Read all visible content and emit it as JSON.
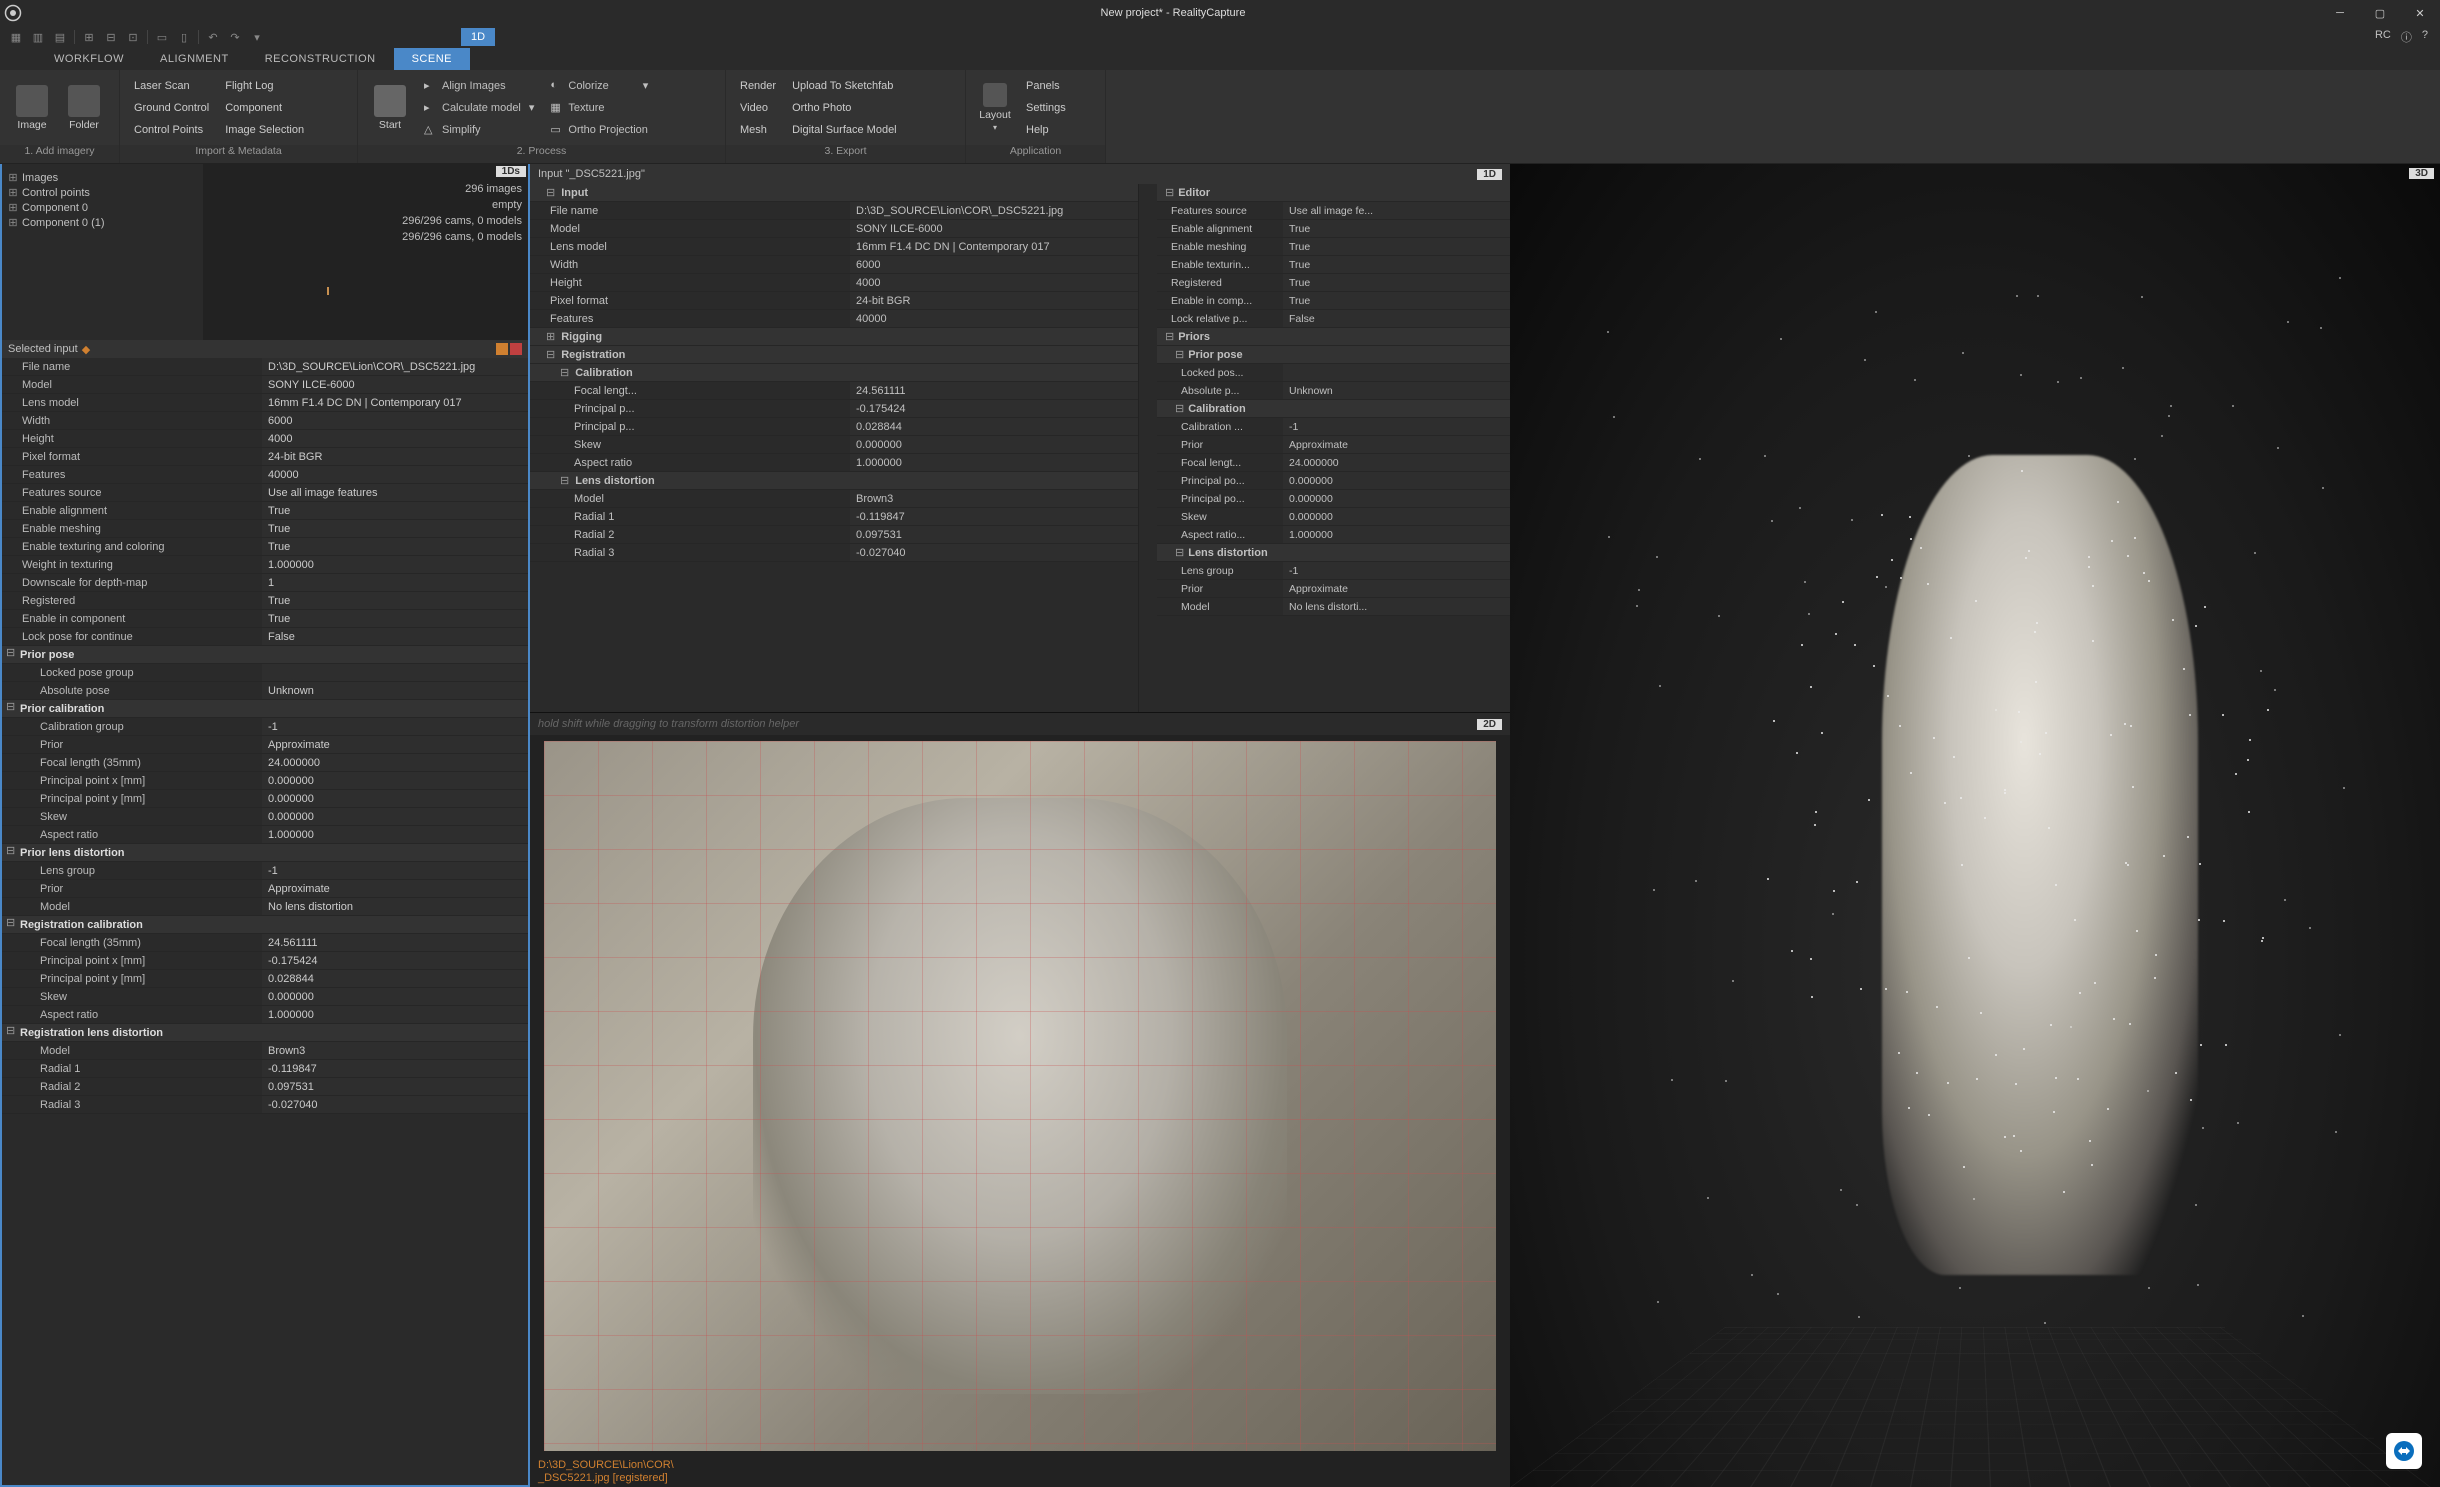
{
  "title": "New project* - RealityCapture",
  "rc_label": "RC",
  "ribbon_tabs": [
    "WORKFLOW",
    "ALIGNMENT",
    "RECONSTRUCTION",
    "SCENE"
  ],
  "active_tab": "SCENE",
  "ribbon": {
    "g1": {
      "label": "1. Add imagery",
      "image": "Image",
      "folder": "Folder",
      "laser": "Laser Scan",
      "flight": "Flight Log",
      "ground": "Ground Control",
      "component": "Component",
      "control": "Control Points",
      "imgsel": "Image Selection"
    },
    "g2": {
      "label": "Import & Metadata"
    },
    "g3": {
      "label": "2. Process",
      "start": "Start",
      "align": "Align Images",
      "calc": "Calculate model",
      "simplify": "Simplify",
      "colorize": "Colorize",
      "texture": "Texture",
      "ortho": "Ortho Projection"
    },
    "g4": {
      "label": "3. Export",
      "render": "Render",
      "video": "Video",
      "mesh": "Mesh",
      "upload": "Upload To Sketchfab",
      "orthop": "Ortho Photo",
      "dsm": "Digital Surface Model"
    },
    "g5": {
      "label": "Application",
      "layout": "Layout",
      "panels": "Panels",
      "settings": "Settings",
      "help": "Help"
    }
  },
  "tree": {
    "images": "Images",
    "control": "Control points",
    "comp0": "Component 0",
    "comp01": "Component 0 (1)"
  },
  "stats": {
    "tag": "1Ds",
    "l1": "296 images",
    "l2": "empty",
    "l3": "296/296 cams, 0 models",
    "l4": "296/296 cams, 0 models"
  },
  "selected_header": "Selected input",
  "sel": [
    {
      "k": "File name",
      "v": "D:\\3D_SOURCE\\Lion\\COR\\_DSC5221.jpg"
    },
    {
      "k": "Model",
      "v": "SONY ILCE-6000"
    },
    {
      "k": "Lens model",
      "v": "16mm F1.4 DC DN | Contemporary 017"
    },
    {
      "k": "Width",
      "v": "6000"
    },
    {
      "k": "Height",
      "v": "4000"
    },
    {
      "k": "Pixel format",
      "v": "24-bit BGR"
    },
    {
      "k": "Features",
      "v": "40000"
    },
    {
      "k": "Features source",
      "v": "Use all image features"
    },
    {
      "k": "Enable alignment",
      "v": "True"
    },
    {
      "k": "Enable meshing",
      "v": "True"
    },
    {
      "k": "Enable texturing and coloring",
      "v": "True"
    },
    {
      "k": "Weight in texturing",
      "v": "1.000000"
    },
    {
      "k": "Downscale for depth-map",
      "v": "1"
    },
    {
      "k": "Registered",
      "v": "True"
    },
    {
      "k": "Enable in component",
      "v": "True"
    },
    {
      "k": "Lock pose for continue",
      "v": "False"
    }
  ],
  "sel_sections": {
    "prior_pose": "Prior pose",
    "prior_pose_rows": [
      {
        "k": "Locked pose group",
        "v": ""
      },
      {
        "k": "Absolute pose",
        "v": "Unknown"
      }
    ],
    "prior_cal": "Prior calibration",
    "prior_cal_rows": [
      {
        "k": "Calibration group",
        "v": "-1"
      },
      {
        "k": "Prior",
        "v": "Approximate"
      },
      {
        "k": "Focal length (35mm)",
        "v": "24.000000"
      },
      {
        "k": "Principal point x [mm]",
        "v": "0.000000"
      },
      {
        "k": "Principal point y [mm]",
        "v": "0.000000"
      },
      {
        "k": "Skew",
        "v": "0.000000"
      },
      {
        "k": "Aspect ratio",
        "v": "1.000000"
      }
    ],
    "prior_lens": "Prior lens distortion",
    "prior_lens_rows": [
      {
        "k": "Lens group",
        "v": "-1"
      },
      {
        "k": "Prior",
        "v": "Approximate"
      },
      {
        "k": "Model",
        "v": "No lens distortion"
      }
    ],
    "reg_cal": "Registration calibration",
    "reg_cal_rows": [
      {
        "k": "Focal length (35mm)",
        "v": "24.561111"
      },
      {
        "k": "Principal point x [mm]",
        "v": "-0.175424"
      },
      {
        "k": "Principal point y [mm]",
        "v": "0.028844"
      },
      {
        "k": "Skew",
        "v": "0.000000"
      },
      {
        "k": "Aspect ratio",
        "v": "1.000000"
      }
    ],
    "reg_lens": "Registration lens distortion",
    "reg_lens_rows": [
      {
        "k": "Model",
        "v": "Brown3"
      },
      {
        "k": "Radial 1",
        "v": "-0.119847"
      },
      {
        "k": "Radial 2",
        "v": "0.097531"
      },
      {
        "k": "Radial 3",
        "v": "-0.027040"
      }
    ]
  },
  "mid_header": "Input \"_DSC5221.jpg\"",
  "mid_tag": "1D",
  "input_section": "Input",
  "input_rows": [
    {
      "k": "File name",
      "v": "D:\\3D_SOURCE\\Lion\\COR\\_DSC5221.jpg"
    },
    {
      "k": "Model",
      "v": "SONY ILCE-6000"
    },
    {
      "k": "Lens model",
      "v": "16mm F1.4 DC DN | Contemporary 017"
    },
    {
      "k": "Width",
      "v": "6000"
    },
    {
      "k": "Height",
      "v": "4000"
    },
    {
      "k": "Pixel format",
      "v": "24-bit BGR"
    },
    {
      "k": "Features",
      "v": "40000"
    }
  ],
  "rigging": "Rigging",
  "registration": "Registration",
  "calibration": "Calibration",
  "cal_rows": [
    {
      "k": "Focal lengt...",
      "v": "24.561111"
    },
    {
      "k": "Principal p...",
      "v": "-0.175424"
    },
    {
      "k": "Principal p...",
      "v": "0.028844"
    },
    {
      "k": "Skew",
      "v": "0.000000"
    },
    {
      "k": "Aspect ratio",
      "v": "1.000000"
    }
  ],
  "lens_dist": "Lens distortion",
  "lens_rows": [
    {
      "k": "Model",
      "v": "Brown3"
    },
    {
      "k": "Radial 1",
      "v": "-0.119847"
    },
    {
      "k": "Radial 2",
      "v": "0.097531"
    },
    {
      "k": "Radial 3",
      "v": "-0.027040"
    }
  ],
  "editor": "Editor",
  "editor_rows": [
    {
      "k": "Features source",
      "v": "Use all image fe..."
    },
    {
      "k": "Enable alignment",
      "v": "True"
    },
    {
      "k": "Enable meshing",
      "v": "True"
    },
    {
      "k": "Enable texturin...",
      "v": "True"
    },
    {
      "k": "Registered",
      "v": "True"
    },
    {
      "k": "Enable in comp...",
      "v": "True"
    },
    {
      "k": "Lock relative p...",
      "v": "False"
    }
  ],
  "priors": "Priors",
  "priors_pose": "Prior pose",
  "priors_pose_rows": [
    {
      "k": "Locked pos...",
      "v": ""
    },
    {
      "k": "Absolute p...",
      "v": "Unknown"
    }
  ],
  "priors_cal": "Calibration",
  "priors_cal_rows": [
    {
      "k": "Calibration ...",
      "v": "-1"
    },
    {
      "k": "Prior",
      "v": "Approximate"
    },
    {
      "k": "Focal lengt...",
      "v": "24.000000"
    },
    {
      "k": "Principal po...",
      "v": "0.000000"
    },
    {
      "k": "Principal po...",
      "v": "0.000000"
    },
    {
      "k": "Skew",
      "v": "0.000000"
    },
    {
      "k": "Aspect ratio...",
      "v": "1.000000"
    }
  ],
  "priors_lens": "Lens distortion",
  "priors_lens_rows": [
    {
      "k": "Lens group",
      "v": "-1"
    },
    {
      "k": "Prior",
      "v": "Approximate"
    },
    {
      "k": "Model",
      "v": "No lens distorti..."
    }
  ],
  "hint2d": "hold shift while dragging to transform distortion helper",
  "tag2d": "2D",
  "tag3d": "3D",
  "status_path": "D:\\3D_SOURCE\\Lion\\COR\\\n_DSC5221.jpg [registered]"
}
